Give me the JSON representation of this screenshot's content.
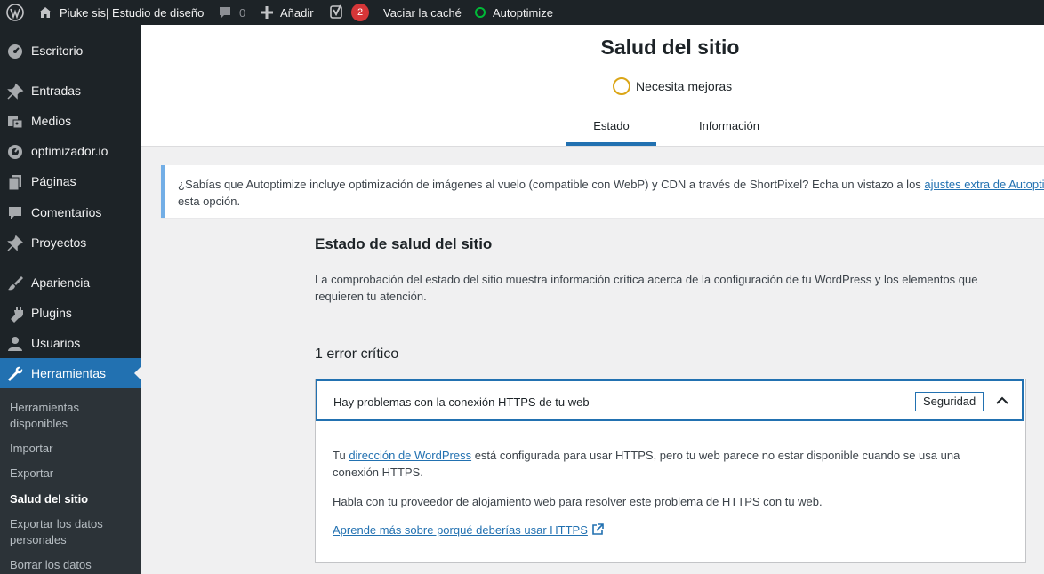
{
  "adminbar": {
    "site_name": "Piuke sis| Estudio de diseño",
    "comments_count": "0",
    "add_new": "Añadir",
    "yoast_count": "2",
    "purge_cache": "Vaciar la caché",
    "autoptimize": "Autoptimize"
  },
  "sidebar": {
    "items": [
      {
        "label": "Escritorio",
        "icon": "dashboard-icon"
      },
      {
        "label": "Entradas",
        "icon": "pin-icon"
      },
      {
        "label": "Medios",
        "icon": "media-icon"
      },
      {
        "label": "optimizador.io",
        "icon": "gauge-icon"
      },
      {
        "label": "Páginas",
        "icon": "pages-icon"
      },
      {
        "label": "Comentarios",
        "icon": "comment-icon"
      },
      {
        "label": "Proyectos",
        "icon": "pin-icon"
      },
      {
        "label": "Apariencia",
        "icon": "brush-icon"
      },
      {
        "label": "Plugins",
        "icon": "plugin-icon"
      },
      {
        "label": "Usuarios",
        "icon": "user-icon"
      },
      {
        "label": "Herramientas",
        "icon": "wrench-icon"
      }
    ],
    "submenu": [
      "Herramientas disponibles",
      "Importar",
      "Exportar",
      "Salud del sitio",
      "Exportar los datos personales",
      "Borrar los datos"
    ]
  },
  "header": {
    "title": "Salud del sitio",
    "status": "Necesita mejoras",
    "tabs": [
      "Estado",
      "Información"
    ]
  },
  "notice": {
    "text": "¿Sabías que Autoptimize incluye optimización de imágenes al vuelo (compatible con WebP) y CDN a través de ShortPixel? Echa un vistazo a los ",
    "link": "ajustes extra de Autoptimize",
    "tail": "esta opción."
  },
  "main": {
    "title": "Estado de salud del sitio",
    "description": "La comprobación del estado del sitio muestra información crítica acerca de la configuración de tu WordPress y los elementos que requieren tu atención.",
    "critical_heading": "1 error crítico"
  },
  "issue": {
    "title": "Hay problemas con la conexión HTTPS de tu web",
    "badge": "Seguridad",
    "p1_before": "Tu ",
    "p1_link": "dirección de WordPress",
    "p1_after": " está configurada para usar HTTPS, pero tu web parece no estar disponible cuando se usa una conexión HTTPS.",
    "p2": "Habla con tu proveedor de alojamiento web para resolver este problema de HTTPS con tu web.",
    "learn_more": "Aprende más sobre porqué deberías usar HTTPS"
  },
  "colors": {
    "adminbar_bg": "#1d2327",
    "accent": "#2271b1",
    "warning": "#dba617",
    "badge_red": "#d63638",
    "status_green": "#00ba37"
  }
}
